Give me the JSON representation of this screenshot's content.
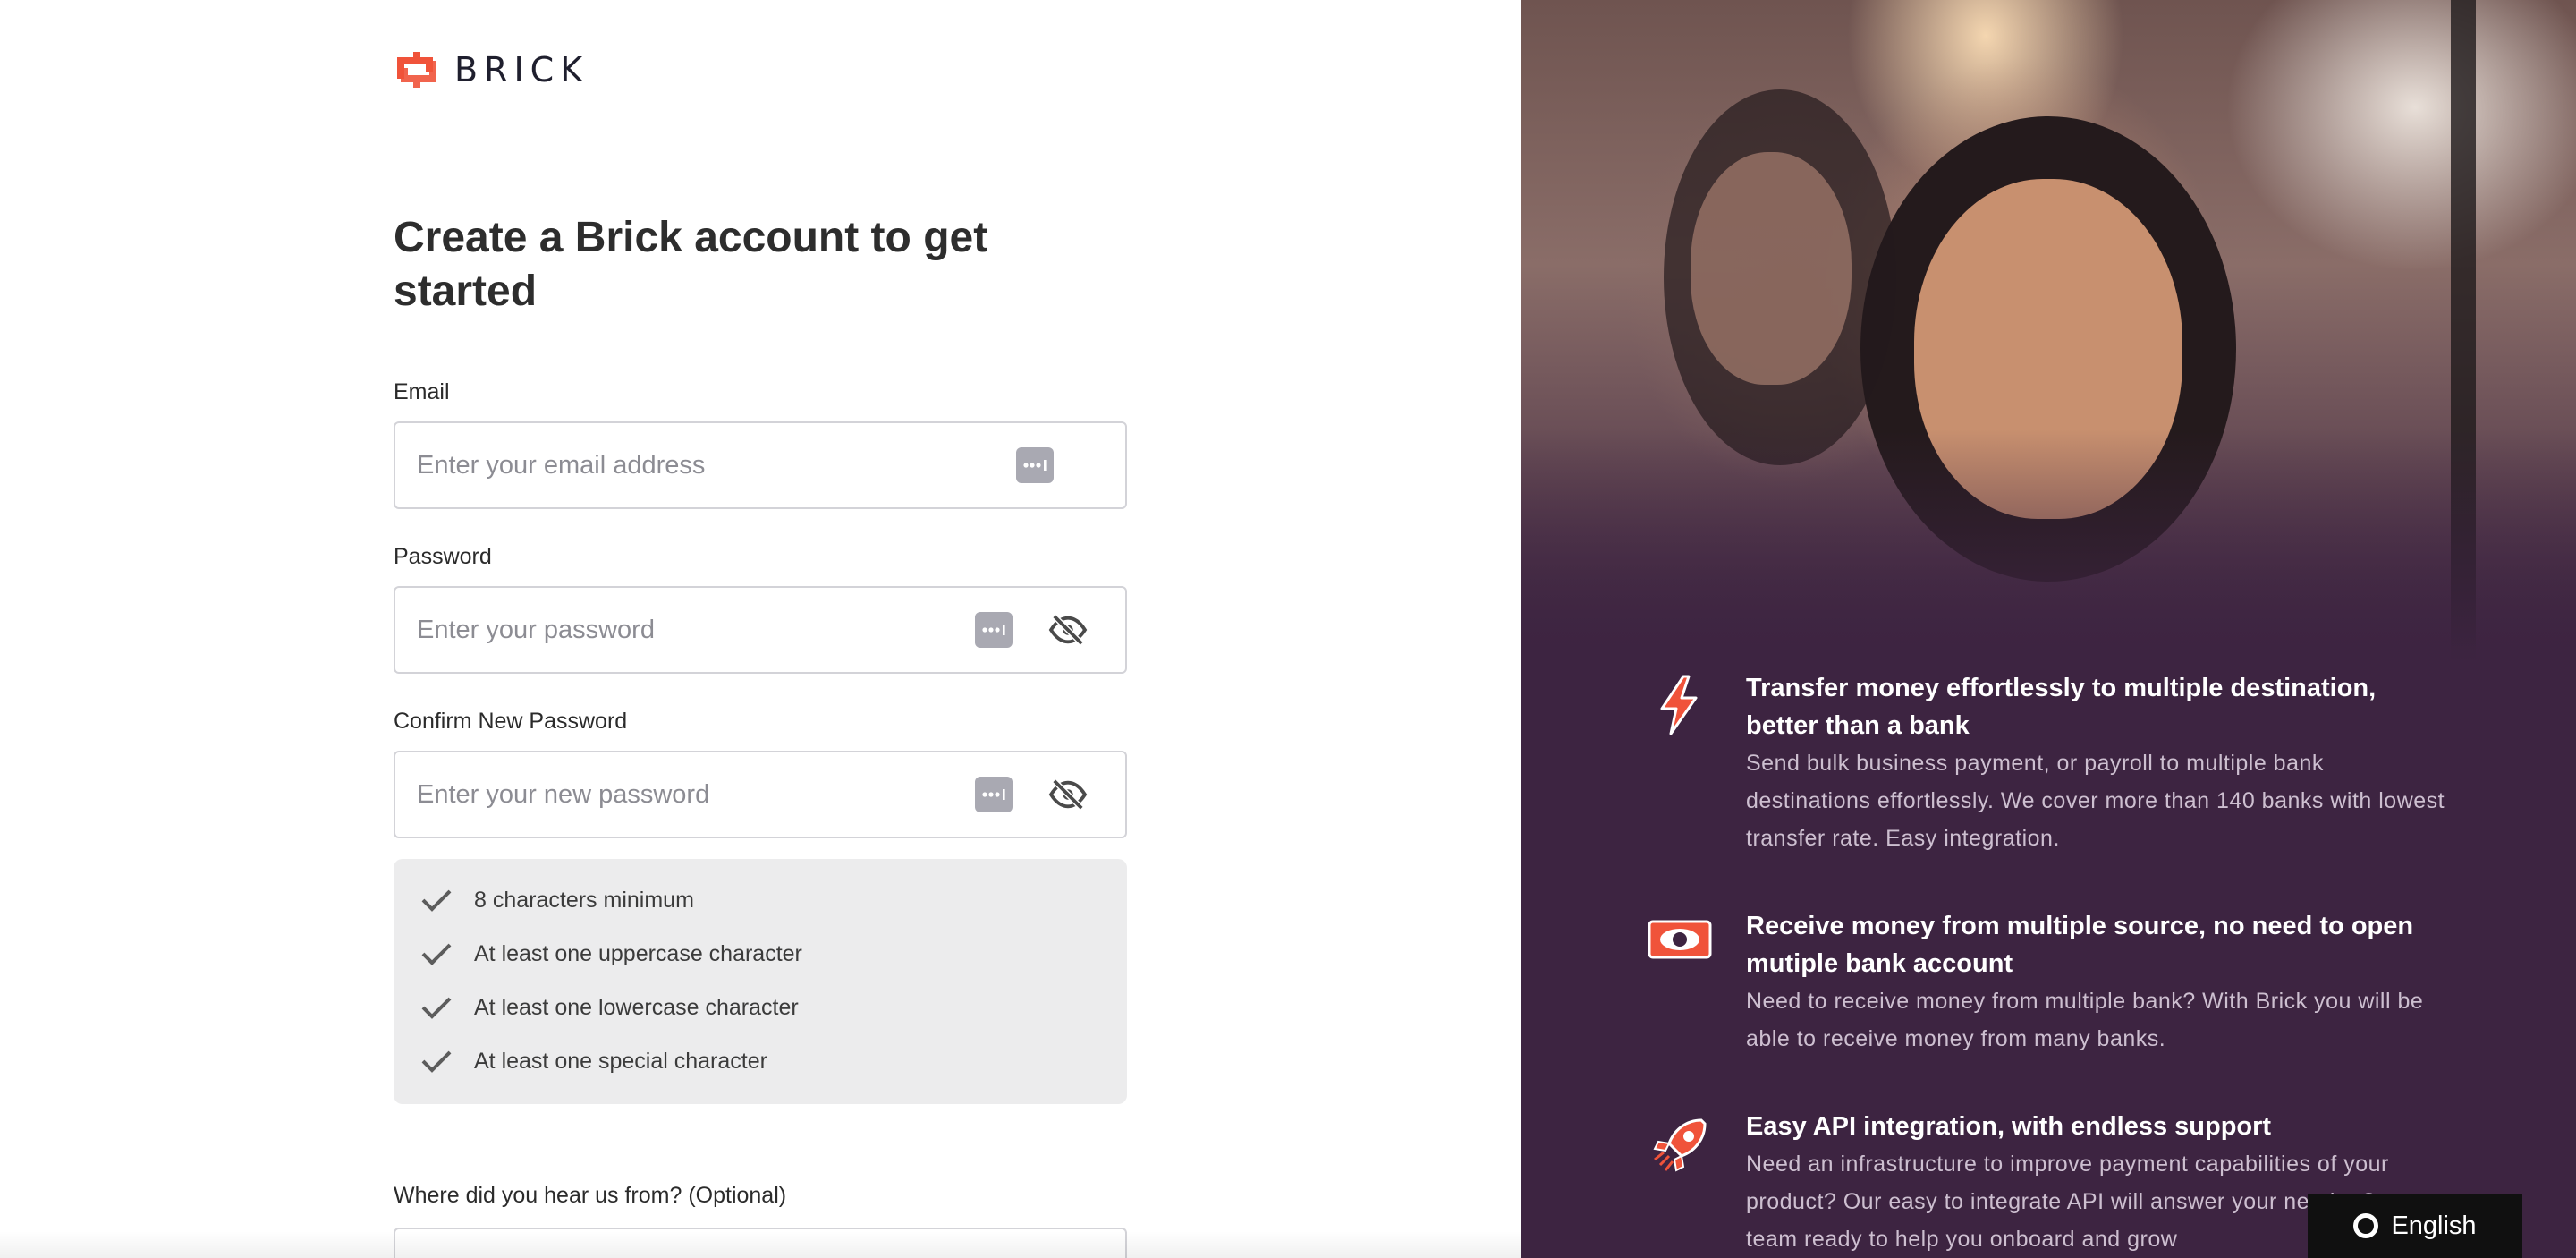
{
  "brand": {
    "name": "BRICK",
    "accent": "#f0533a",
    "panel_bg": "#3d2441"
  },
  "form": {
    "title": "Create a Brick account to get started",
    "email": {
      "label": "Email",
      "placeholder": "Enter your email address",
      "value": ""
    },
    "password": {
      "label": "Password",
      "placeholder": "Enter your password",
      "value": ""
    },
    "confirm": {
      "label": "Confirm New Password",
      "placeholder": "Enter your new password",
      "value": ""
    },
    "rules": [
      "8 characters minimum",
      "At least one uppercase character",
      "At least one lowercase character",
      "At least one special character"
    ],
    "source": {
      "label": "Where did you hear us from? (Optional)"
    }
  },
  "features": [
    {
      "icon": "lightning-icon",
      "title": "Transfer money effortlessly to multiple destination, better than a bank",
      "desc": "Send bulk business payment, or payroll to multiple bank destinations effortlessly. We cover more than 140 banks with lowest transfer rate. Easy integration."
    },
    {
      "icon": "banknote-icon",
      "title": "Receive money from multiple source, no need to open mutiple bank account",
      "desc": "Need to receive money from multiple bank? With Brick you will be able to receive money from many banks."
    },
    {
      "icon": "rocket-icon",
      "title": "Easy API integration, with endless support",
      "desc": "Need an infrastructure to improve payment capabilities of your product? Our easy to integrate API will answer your needs. Our team ready to help you onboard and grow"
    }
  ],
  "language": {
    "label": "English"
  }
}
